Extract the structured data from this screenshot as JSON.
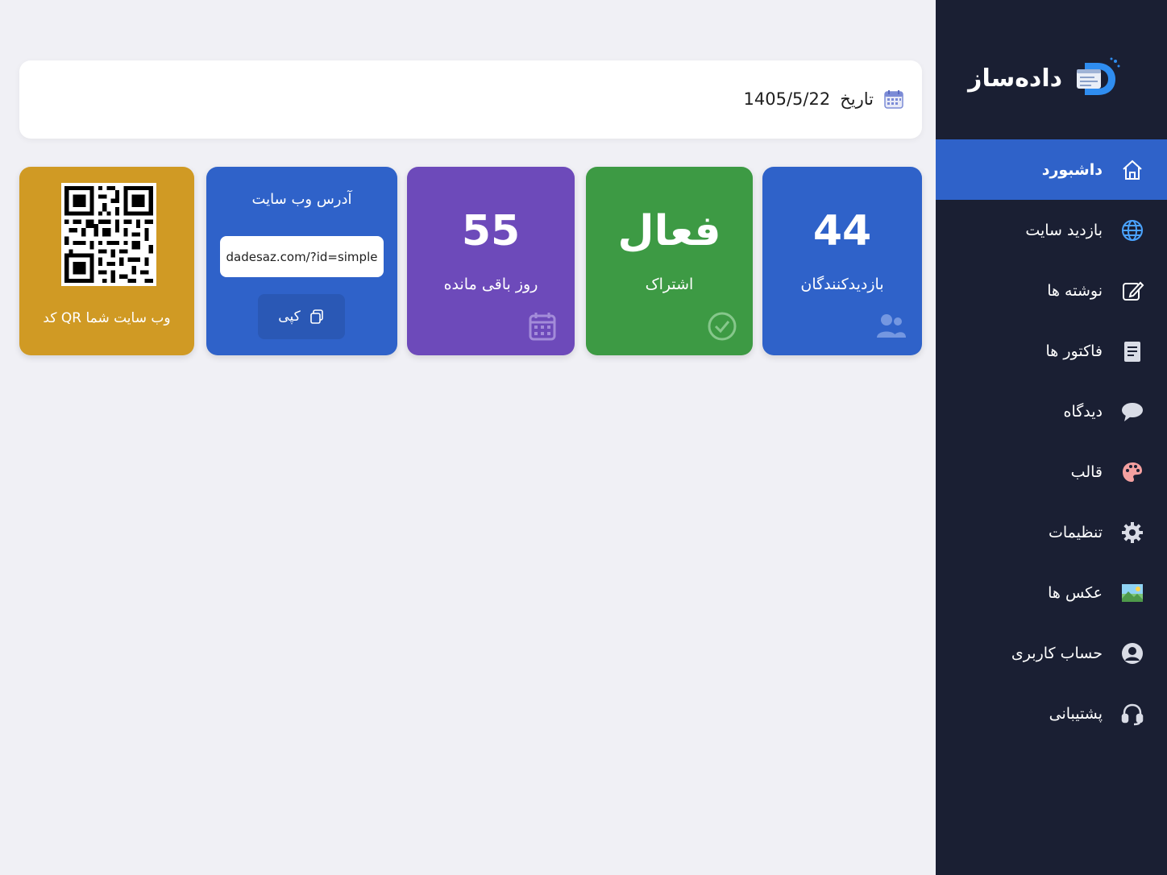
{
  "brand": {
    "name": "داده‌ساز",
    "logo_icon": "dadesaz-logo-icon"
  },
  "header": {
    "date_label": "تاریخ",
    "date_value": "1405/5/22",
    "date_icon": "calendar-icon"
  },
  "stats": {
    "visitors": {
      "value": "44",
      "label": "بازدیدکنندگان",
      "icon": "users-icon",
      "color": "#2f62c9"
    },
    "subscription": {
      "value": "فعال",
      "label": "اشتراک",
      "icon": "check-circle-icon",
      "color": "#3d9a44"
    },
    "days": {
      "value": "55",
      "label": "روز باقی مانده",
      "icon": "calendar-icon",
      "color": "#6d4aba"
    }
  },
  "website": {
    "title": "آدرس وب سایت",
    "url": "dadesaz.com/?id=simple",
    "copy_label": "کپی",
    "color": "#2f62c9"
  },
  "qr": {
    "caption": "کد QR وب سایت شما",
    "color": "#d09a24"
  },
  "nav": {
    "items": [
      {
        "label": "داشبورد",
        "icon": "home-icon",
        "active": true
      },
      {
        "label": "بازدید سایت",
        "icon": "globe-icon"
      },
      {
        "label": "نوشته ها",
        "icon": "edit-icon"
      },
      {
        "label": "فاکتور ها",
        "icon": "invoice-icon"
      },
      {
        "label": "دیدگاه",
        "icon": "comment-icon"
      },
      {
        "label": "قالب",
        "icon": "palette-icon"
      },
      {
        "label": "تنظیمات",
        "icon": "gear-icon"
      },
      {
        "label": "عکس ها",
        "icon": "image-icon"
      },
      {
        "label": "حساب کاربری",
        "icon": "user-circle-icon"
      },
      {
        "label": "پشتیبانی",
        "icon": "headset-icon"
      }
    ]
  },
  "colors": {
    "sidebar_bg": "#1a1f33",
    "active_bg": "#2f62c9",
    "page_bg": "#f0f0f5"
  }
}
